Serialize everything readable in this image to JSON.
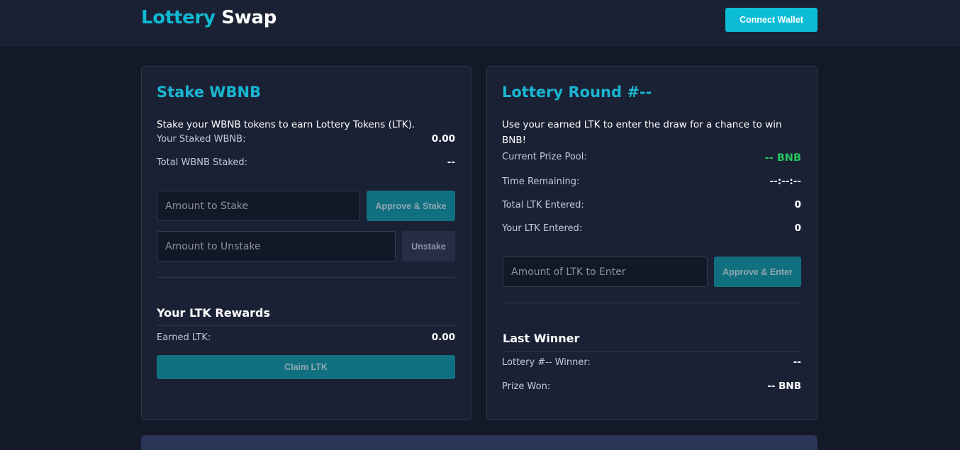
{
  "header": {
    "logo_part1": "Lottery",
    "logo_part2": "Swap",
    "connect_label": "Connect Wallet"
  },
  "stake": {
    "title": "Stake WBNB",
    "description": "Stake your WBNB tokens to earn Lottery Tokens (LTK).",
    "staked_label": "Your Staked WBNB:",
    "staked_value": "0.00",
    "total_label": "Total WBNB Staked:",
    "total_value": "--",
    "stake_placeholder": "Amount to Stake",
    "stake_button": "Approve & Stake",
    "unstake_placeholder": "Amount to Unstake",
    "unstake_button": "Unstake",
    "rewards_title": "Your LTK Rewards",
    "earned_label": "Earned LTK:",
    "earned_value": "0.00",
    "claim_button": "Claim LTK"
  },
  "lottery": {
    "title": "Lottery Round #--",
    "description_line1": "Use your earned LTK to enter the draw for a chance to win",
    "description_line2": "BNB!",
    "prize_label": "Current Prize Pool:",
    "prize_value": "-- BNB",
    "time_label": "Time Remaining:",
    "time_value": "--:--:--",
    "total_ltk_label": "Total LTK Entered:",
    "total_ltk_value": "0",
    "your_ltk_label": "Your LTK Entered:",
    "your_ltk_value": "0",
    "enter_placeholder": "Amount of LTK to Enter",
    "enter_button": "Approve & Enter",
    "last_winner_title": "Last Winner",
    "winner_label": "Lottery #-- Winner:",
    "winner_value": "--",
    "prize_won_label": "Prize Won:",
    "prize_won_value": "-- BNB"
  },
  "colors": {
    "accent": "#0cbcd6",
    "background": "#141928",
    "card": "#1b2134",
    "prize_green": "#22c55e"
  }
}
